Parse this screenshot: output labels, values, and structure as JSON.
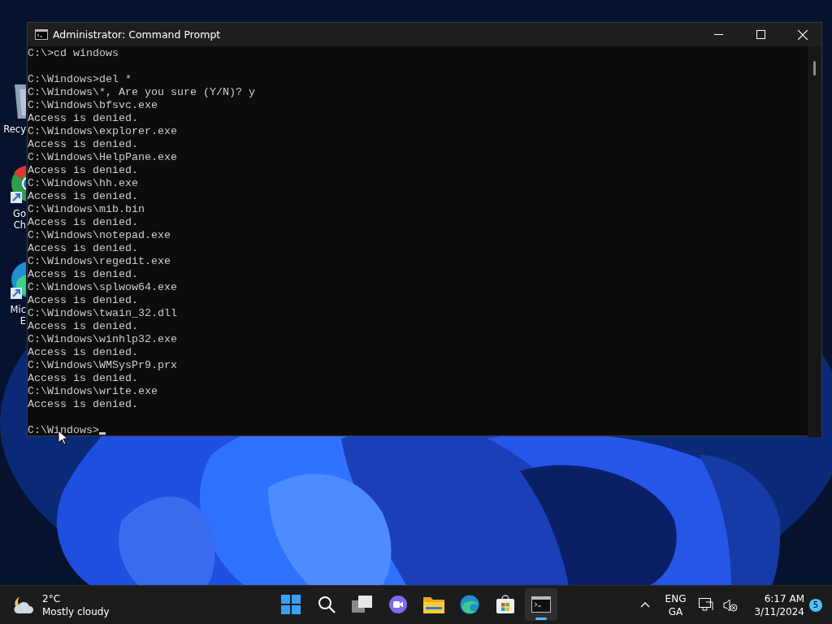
{
  "desktop_icons": [
    {
      "kind": "bin",
      "label": [
        "Recy"
      ]
    },
    {
      "kind": "chrome",
      "label": [
        "Go",
        "Ch"
      ]
    },
    {
      "kind": "edge",
      "label": [
        "Mic",
        "E"
      ]
    }
  ],
  "window": {
    "title": "Administrator: Command Prompt",
    "blocks": [
      [
        "C:\\>cd windows"
      ],
      [
        "C:\\Windows>del *",
        "C:\\Windows\\*, Are you sure (Y/N)? y",
        "C:\\Windows\\bfsvc.exe",
        "Access is denied.",
        "C:\\Windows\\explorer.exe",
        "Access is denied.",
        "C:\\Windows\\HelpPane.exe",
        "Access is denied.",
        "C:\\Windows\\hh.exe",
        "Access is denied.",
        "C:\\Windows\\mib.bin",
        "Access is denied.",
        "C:\\Windows\\notepad.exe",
        "Access is denied.",
        "C:\\Windows\\regedit.exe",
        "Access is denied.",
        "C:\\Windows\\splwow64.exe",
        "Access is denied.",
        "C:\\Windows\\twain_32.dll",
        "Access is denied.",
        "C:\\Windows\\winhlp32.exe",
        "Access is denied.",
        "C:\\Windows\\WMSysPr9.prx",
        "Access is denied.",
        "C:\\Windows\\write.exe",
        "Access is denied."
      ],
      [
        "C:\\Windows>"
      ]
    ]
  },
  "taskbar": {
    "weather": {
      "temperature": "2°C",
      "condition": "Mostly cloudy"
    },
    "apps": [
      {
        "kind": "start",
        "selected": false
      },
      {
        "kind": "search",
        "selected": false
      },
      {
        "kind": "taskview",
        "selected": false
      },
      {
        "kind": "meet",
        "selected": false
      },
      {
        "kind": "explorer",
        "selected": false
      },
      {
        "kind": "edge",
        "selected": false
      },
      {
        "kind": "store",
        "selected": false
      },
      {
        "kind": "terminal",
        "selected": true
      }
    ],
    "language": [
      "ENG",
      "GA"
    ],
    "time": "6:17 AM",
    "date": "3/11/2024",
    "notifications": "5"
  }
}
